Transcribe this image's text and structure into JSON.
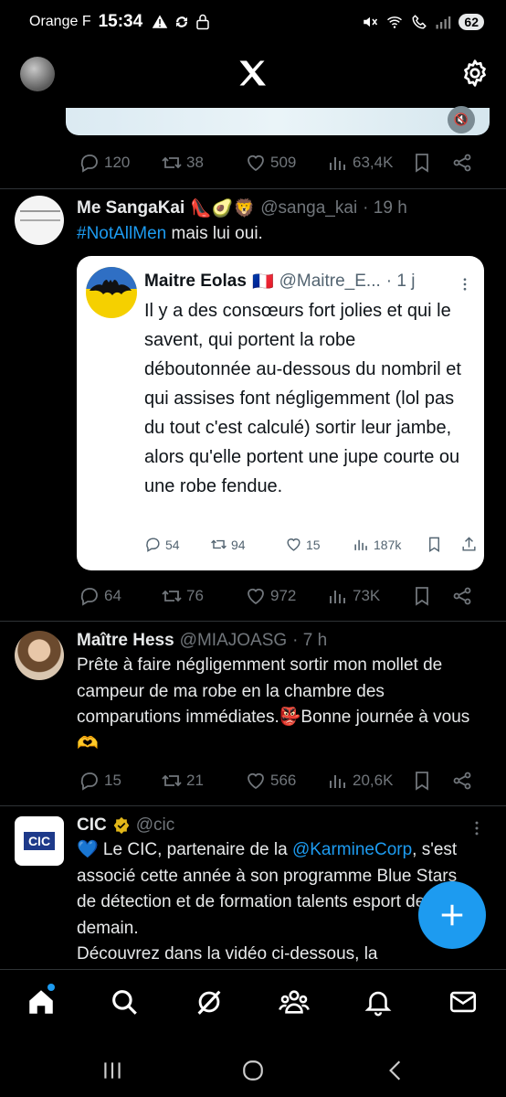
{
  "status_bar": {
    "carrier": "Orange F",
    "time": "15:34",
    "battery": "62"
  },
  "top_bar": {
    "logo": "x-logo",
    "settings_icon": "gear-icon"
  },
  "previous_tweet": {
    "stats": {
      "replies": "120",
      "reposts": "38",
      "likes": "509",
      "views": "63,4K"
    }
  },
  "tweets": [
    {
      "name": "Me SangaKai",
      "emojis": "👠🥑🦁",
      "handle": "@sanga_kai",
      "time": "· 19 h",
      "hashtag": "#NotAllMen",
      "text_after": " mais lui oui.",
      "quote": {
        "name": "Maitre Eolas",
        "flag": "🇫🇷",
        "handle": "@Maitre_E...",
        "time": "· 1 j",
        "text": "Il y a des consœurs fort jolies et qui le savent, qui portent la robe déboutonnée au-dessous du nombril et qui assises font négligemment (lol pas du tout c'est calculé) sortir leur jambe, alors qu'elle portent une jupe courte ou une robe fendue.",
        "stats": {
          "replies": "54",
          "reposts": "94",
          "likes": "15",
          "views": "187k"
        }
      },
      "stats": {
        "replies": "64",
        "reposts": "76",
        "likes": "972",
        "views": "73K"
      }
    },
    {
      "name": "Maître Hess",
      "handle": "@MIAJOASG",
      "time": "· 7 h",
      "text": "Prête à faire négligemment sortir mon mollet de campeur de ma robe en la chambre des comparutions immédiates.👺Bonne journée à vous 🫶",
      "stats": {
        "replies": "15",
        "reposts": "21",
        "likes": "566",
        "views": "20,6K"
      }
    },
    {
      "name": "CIC",
      "handle": "@cic",
      "text_before": "💙 Le CIC, partenaire de la ",
      "mention": "@KarmineCorp",
      "text_after": ", s'est associé cette année à son programme Blue Stars de détection et de formation talents esport de demain.",
      "text_line2": "Découvrez dans la vidéo ci-dessous, la",
      "avatar_text": "CIC"
    }
  ],
  "bottom_nav": [
    "home-icon",
    "search-icon",
    "grok-icon",
    "communities-icon",
    "notifications-icon",
    "messages-icon"
  ],
  "colors": {
    "accent": "#1d9bf0",
    "background": "#000000",
    "muted": "#71767b"
  }
}
